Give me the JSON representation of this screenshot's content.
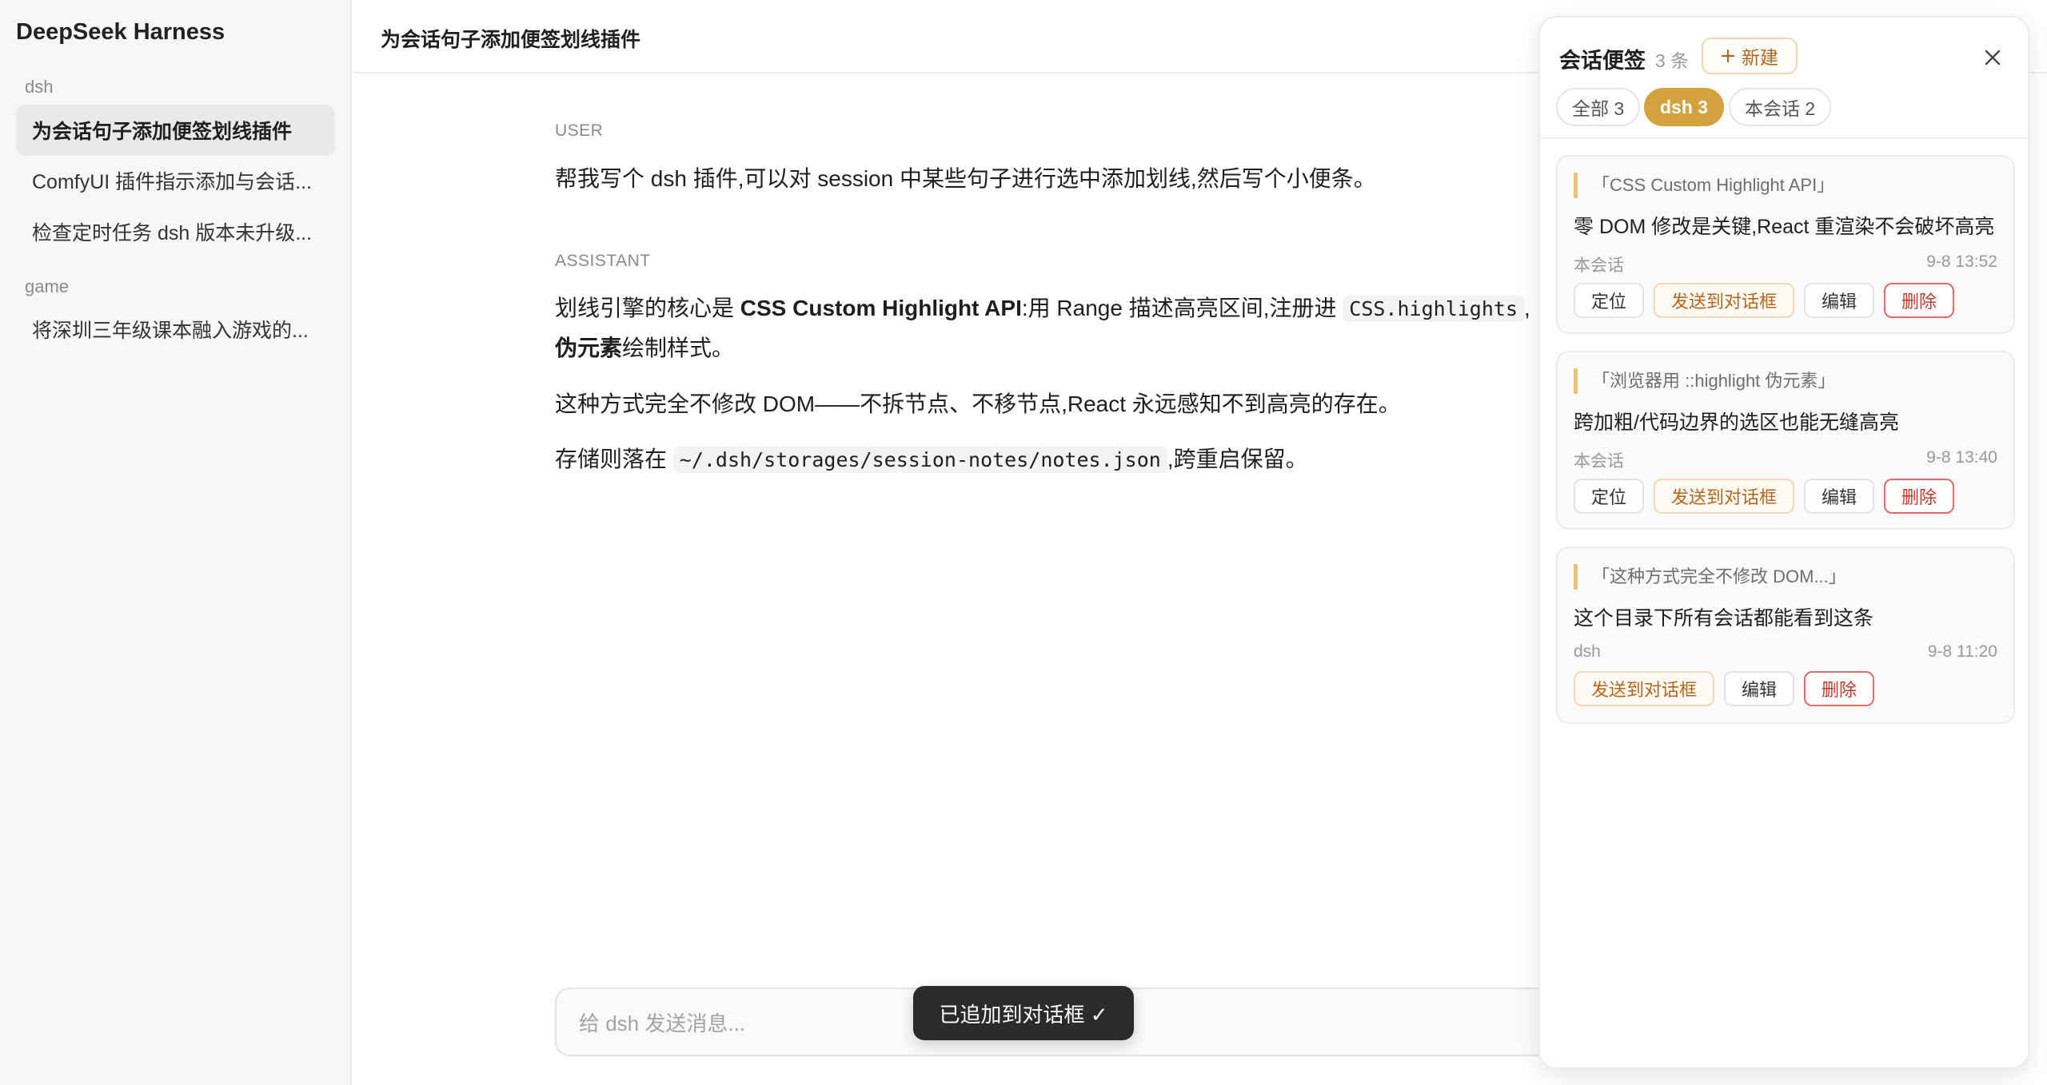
{
  "sidebar": {
    "app_title": "DeepSeek Harness",
    "groups": [
      {
        "label": "dsh",
        "items": [
          {
            "label": "为会话句子添加便签划线插件",
            "active": true
          },
          {
            "label": "ComfyUI 插件指示添加与会话..."
          },
          {
            "label": "检查定时任务 dsh 版本未升级..."
          }
        ]
      },
      {
        "label": "game",
        "items": [
          {
            "label": "将深圳三年级课本融入游戏的..."
          }
        ]
      }
    ]
  },
  "conversation": {
    "title": "为会话句子添加便签划线插件",
    "user": {
      "role": "USER",
      "text": "帮我写个 dsh 插件,可以对 session 中某些句子进行选中添加划线,然后写个小便条。"
    },
    "assistant": {
      "role": "ASSISTANT",
      "line1_a": "划线引擎的核心是 ",
      "line1_bold": "CSS Custom Highlight API",
      "line1_b": ":用 Range 描述高亮区间,注册进 ",
      "line1_code": "CSS.highlights",
      "line1_c": ",",
      "line2_bold": "伪元素",
      "line2_rest": "绘制样式。",
      "para2": "这种方式完全不修改 DOM——不拆节点、不移节点,React 永远感知不到高亮的存在。",
      "para3_a": "存储则落在 ",
      "para3_code": "~/.dsh/storages/session-notes/notes.json",
      "para3_b": ",跨重启保留。"
    },
    "composer_placeholder": "给 dsh 发送消息...",
    "toast": "已追加到对话框 ✓"
  },
  "notes_panel": {
    "title": "会话便签",
    "count": "3 条",
    "new_label": "新建",
    "new_icon": "plus-icon",
    "close_icon": "close-icon",
    "tabs": [
      {
        "label": "全部 3"
      },
      {
        "label": "dsh 3",
        "active": true
      },
      {
        "label": "本会话 2"
      }
    ],
    "notes": [
      {
        "quote": "「CSS Custom Highlight API」",
        "text": "零 DOM 修改是关键,React 重渲染不会破坏高亮",
        "scope": "本会话",
        "time": "9-8 13:52",
        "actions": {
          "locate": "定位",
          "send": "发送到对话框",
          "edit": "编辑",
          "delete": "删除"
        }
      },
      {
        "quote": "「浏览器用 ::highlight 伪元素」",
        "text": "跨加粗/代码边界的选区也能无缝高亮",
        "scope": "本会话",
        "time": "9-8 13:40",
        "actions": {
          "locate": "定位",
          "send": "发送到对话框",
          "edit": "编辑",
          "delete": "删除"
        }
      },
      {
        "quote": "「这种方式完全不修改 DOM...」",
        "text": "这个目录下所有会话都能看到这条",
        "scope": "dsh",
        "time": "9-8 11:20",
        "actions": {
          "send": "发送到对话框",
          "edit": "编辑",
          "delete": "删除"
        }
      }
    ]
  },
  "colors": {
    "accent": "#d3a23c",
    "quote_bar": "#e6c27a",
    "send_text": "#b5651d",
    "delete": "#c0392b"
  }
}
